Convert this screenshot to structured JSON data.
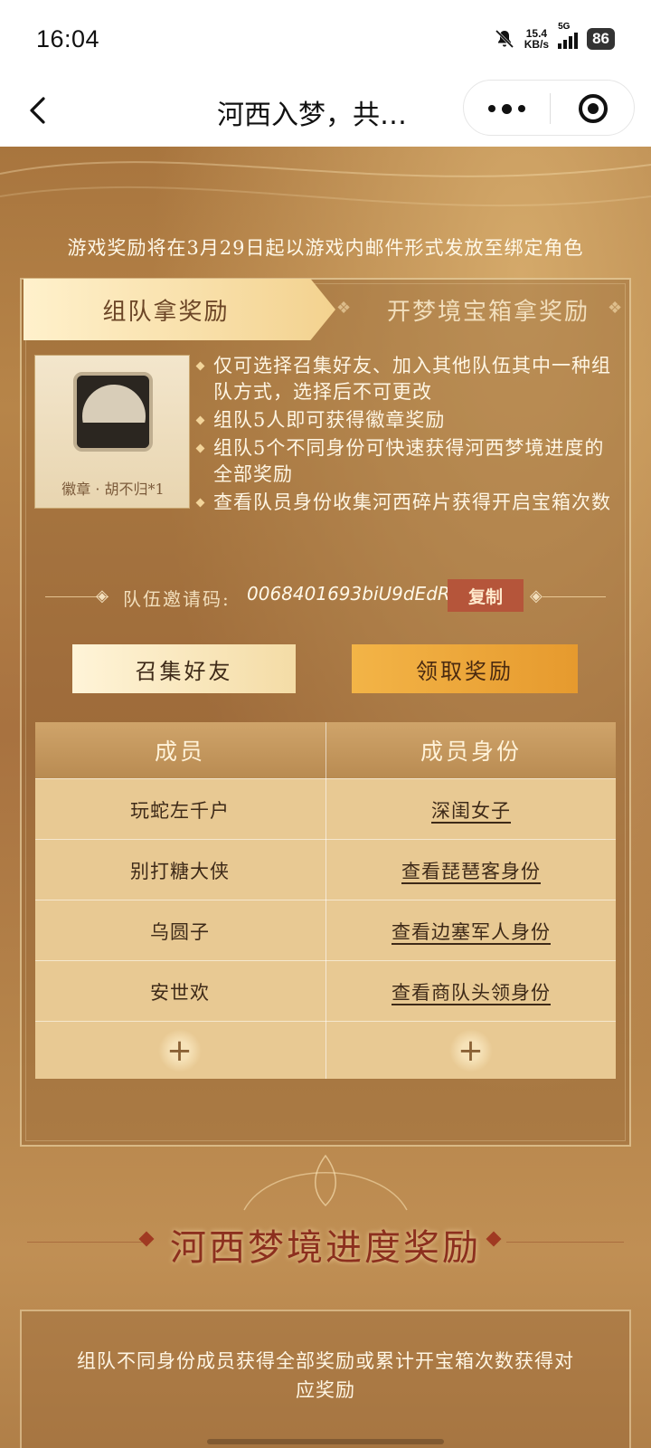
{
  "status_bar": {
    "time": "16:04",
    "net_speed_value": "15.4",
    "net_speed_unit": "KB/s",
    "network_type": "5G",
    "battery": "86",
    "icons": [
      "mute-bell-icon",
      "signal-icon",
      "battery-icon"
    ]
  },
  "nav": {
    "title": "河西入梦，共…",
    "icons": [
      "back-chevron-icon",
      "more-dots-icon",
      "close-target-icon"
    ]
  },
  "page": {
    "notice": "游戏奖励将在3月29日起以游戏内邮件形式发放至绑定角色",
    "tabs": [
      {
        "label": "组队拿奖励",
        "active": true
      },
      {
        "label": "开梦境宝箱拿奖励",
        "active": false
      }
    ],
    "badge": {
      "label": "徽章 · 胡不归*1"
    },
    "rules": [
      "仅可选择召集好友、加入其他队伍其中一种组队方式，选择后不可更改",
      "组队5人即可获得徽章奖励",
      "组队5个不同身份可快速获得河西梦境进度的全部奖励",
      "查看队员身份收集河西碎片获得开启宝箱次数"
    ],
    "invite": {
      "label": "队伍邀请码:",
      "code": "0068401693biU9dEdR",
      "copy_label": "复制"
    },
    "buttons": {
      "gather": "召集好友",
      "claim": "领取奖励"
    },
    "table": {
      "headers": [
        "成员",
        "成员身份"
      ],
      "rows": [
        {
          "member": "玩蛇左千户",
          "identity": "深闺女子"
        },
        {
          "member": "别打糖大侠",
          "identity": "查看琵琶客身份"
        },
        {
          "member": "乌圆子",
          "identity": "查看边塞军人身份"
        },
        {
          "member": "安世欢",
          "identity": "查看商队头领身份"
        }
      ],
      "add_symbol": "+"
    },
    "progress_section": {
      "title": "河西梦境进度奖励",
      "description": "组队不同身份成员获得全部奖励或累计开宝箱次数获得对应奖励"
    },
    "colors": {
      "background": "#b07f48",
      "tab_active": "#f3d28f",
      "copy_button": "#b5553a",
      "claim_button": "#e69a2e",
      "section_title": "#8c2f1e"
    }
  }
}
